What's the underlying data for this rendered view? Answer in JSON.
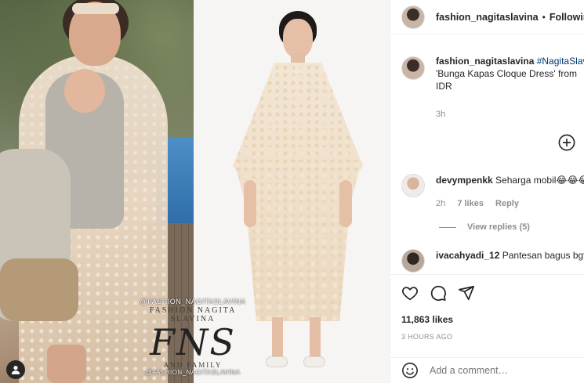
{
  "watermark": {
    "handle_top": "@FASHION_NAGITASLAVINA",
    "name": "FASHION NAGITA SLAVINA",
    "logo": "FNS",
    "sub": "AND FAMILY",
    "handle_bottom": "@FASHION_NAGITASLAVINA"
  },
  "header": {
    "username": "fashion_nagitaslavina",
    "separator": "•",
    "follow_label": "Following"
  },
  "caption": {
    "username": "fashion_nagitaslavina",
    "hashtag": "#NagitaSlavina",
    "line2": "'Bunga Kapas Cloque Dress' from",
    "line3": "IDR",
    "time": "3h"
  },
  "comments": [
    {
      "username": "devympenkk",
      "text": "Seharga mobil😂😂😂",
      "time": "2h",
      "likes": "7 likes",
      "reply": "Reply"
    },
    {
      "username": "ivacahyadi_12",
      "text": "Pantesan bagus bgt"
    }
  ],
  "view_replies": "View replies (5)",
  "likes": "11,863 likes",
  "posted_ago": "3 HOURS AGO",
  "add_comment_placeholder": "Add a comment…",
  "icons": [
    "user-tag-icon",
    "add-circle-icon",
    "heart-icon",
    "comment-icon",
    "share-icon",
    "emoji-icon"
  ],
  "colors": {
    "hashtag": "#00376b",
    "muted": "#8e8e8e",
    "text": "#262626"
  }
}
